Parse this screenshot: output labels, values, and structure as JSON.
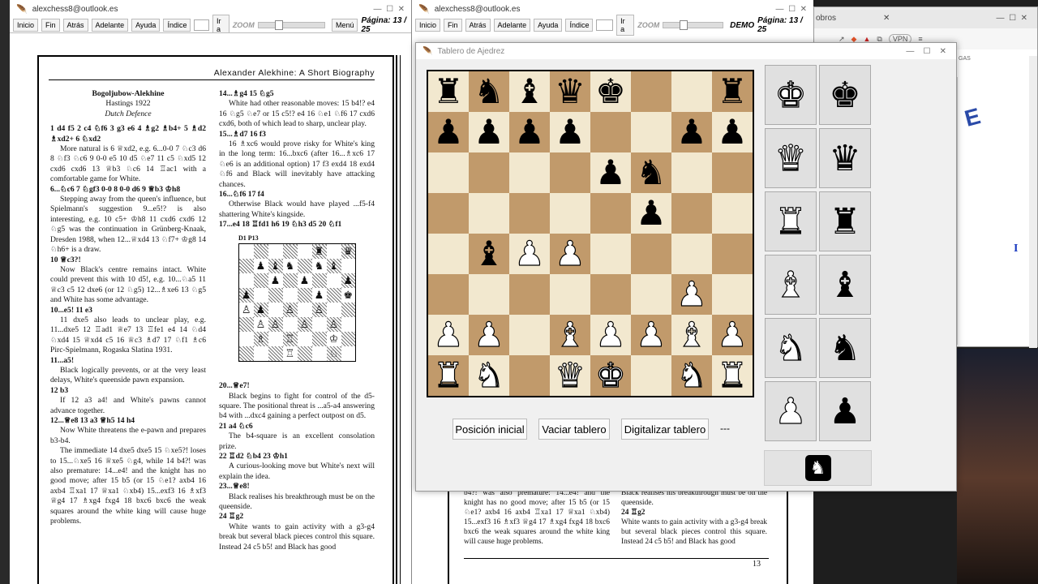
{
  "left_window": {
    "title": "alexchess8@outlook.es",
    "toolbar": [
      "Inicio",
      "Fin",
      "Atrás",
      "Adelante",
      "Ayuda",
      "Índice",
      "Ir a"
    ],
    "zoom": "ZOOM",
    "menu": "Menú",
    "page": "Página: 13 / 25"
  },
  "right_window": {
    "title": "alexchess8@outlook.es",
    "toolbar": [
      "Inicio",
      "Fin",
      "Atrás",
      "Adelante",
      "Ayuda",
      "Índice",
      "Ir a"
    ],
    "zoom": "ZOOM",
    "demo": "DEMO",
    "page": "Página: 13 / 25"
  },
  "browser": {
    "tab": "obros",
    "vpn": "VPN",
    "gas": "GAS",
    "link": "I"
  },
  "doc": {
    "header": "Alexander Alekhine: A Short Biography",
    "game_title": "Bogoljubow-Alekhine",
    "event": "Hastings 1922",
    "opening": "Dutch Defence",
    "left_col": [
      {
        "t": "1 d4 f5 2 c4 ♘f6 3 g3 e6 4 ♗g2 ♗b4+ 5 ♗d2 ♗xd2+ 6 ♘xd2",
        "b": true
      },
      {
        "t": "More natural is 6 ♕xd2, e.g. 6...0-0 7 ♘c3 d6 8 ♘f3 ♘c6 9 0-0 e5 10 d5 ♘e7 11 c5 ♘xd5 12 cxd6 cxd6 13 ♕b3 ♘c6 14 ♖ac1 with a comfortable game for White."
      },
      {
        "t": "6...♘c6 7 ♘gf3 0-0 8 0-0 d6 9 ♕b3 ♔h8",
        "b": true
      },
      {
        "t": "Stepping away from the queen's influence, but Spielmann's suggestion 9...e5!? is also interesting, e.g. 10 c5+ ♔h8 11 cxd6 cxd6 12 ♘g5 was the continuation in Grünberg-Knaak, Dresden 1988, when 12...♕xd4 13 ♘f7+ ♔g8 14 ♘h6+ is a draw."
      },
      {
        "t": "10 ♕c3?!",
        "b": true
      },
      {
        "t": "Now Black's centre remains intact. White could prevent this with 10 d5!, e.g. 10...♘a5 11 ♕c3 c5 12 dxe6 (or 12 ♘g5) 12...♗xe6 13 ♘g5 and White has some advantage."
      },
      {
        "t": "10...e5! 11 e3",
        "b": true
      },
      {
        "t": "11 dxe5 also leads to unclear play, e.g. 11...dxe5 12 ♖ad1 ♕e7 13 ♖fe1 e4 14 ♘d4 ♘xd4 15 ♕xd4 c5 16 ♕c3 ♗d7 17 ♘f1 ♗c6 Pirc-Spielmann, Rogaska Slatina 1931."
      },
      {
        "t": "11...a5!",
        "b": true
      },
      {
        "t": "Black logically prevents, or at the very least delays, White's queenside pawn expansion."
      },
      {
        "t": "12 b3",
        "b": true
      },
      {
        "t": "If 12 a3 a4! and White's pawns cannot advance together."
      },
      {
        "t": "12...♕e8 13 a3 ♕h5 14 h4",
        "b": true
      },
      {
        "t": "Now White threatens the e-pawn and prepares b3-b4."
      },
      {
        "t": "The immediate 14 dxe5 dxe5 15 ♘xe5?! loses to 15...♘xe5 16 ♕xe5 ♘g4, while 14 b4?! was also premature: 14...e4! and the knight has no good move; after 15 b5 (or 15 ♘e1? axb4 16 axb4 ♖xa1 17 ♕xa1 ♘xb4) 15...exf3 16 ♗xf3 ♕g4 17 ♗xg4 fxg4 18 bxc6 bxc6 the weak squares around the white king will cause huge problems."
      }
    ],
    "right_col_a": [
      {
        "t": "14...♗g4 15 ♘g5",
        "b": true
      },
      {
        "t": "White had other reasonable moves: 15 b4!? e4 16 ♘g5 ♘e7 or 15 c5!? e4 16 ♘e1 ♘f6 17 cxd6 cxd6, both of which lead to sharp, unclear play."
      },
      {
        "t": "15...♗d7 16 f3",
        "b": true
      },
      {
        "t": "16 ♗xc6 would prove risky for White's king in the long term: 16...bxc6 (after 16...♗xc6 17 ♘e6 is an additional option) 17 f3 exd4 18 exd4 ♘f6 and Black will inevitably have attacking chances."
      },
      {
        "t": "16...♘f6 17 f4",
        "b": true
      },
      {
        "t": "Otherwise Black would have played ...f5-f4 shattering White's kingside."
      },
      {
        "t": "17...e4 18 ♖fd1 h6 19 ♘h3 d5 20 ♘f1",
        "b": true
      }
    ],
    "diagram_label": "D1 P13",
    "right_col_b": [
      {
        "t": "20...♕e7!",
        "b": true
      },
      {
        "t": "Black begins to fight for control of the d5-square. The positional threat is ...a5-a4 answering b4 with ...dxc4 gaining a perfect outpost on d5."
      },
      {
        "t": "21 a4 ♘c6",
        "b": true
      },
      {
        "t": "The b4-square is an excellent consolation prize."
      },
      {
        "t": "22 ♖d2 ♘b4 23 ♔h1",
        "b": true
      },
      {
        "t": "A curious-looking move but White's next will explain the idea."
      },
      {
        "t": "23...♕e8!",
        "b": true
      },
      {
        "t": "Black realises his breakthrough must be on the queenside."
      },
      {
        "t": "24 ♖g2",
        "b": true
      },
      {
        "t": "White wants to gain activity with a g3-g4 break but several black pieces control this square. Instead 24 c5 b5! and Black has good"
      }
    ],
    "right_page_left": "b4?! was also premature: 14...e4! and the knight has no good move; after 15 b5 (or 15 ♘e1? axb4 16 axb4 ♖xa1 17 ♕xa1 ♘xb4) 15...exf3 16 ♗xf3 ♕g4 17 ♗xg4 fxg4 18 bxc6 bxc6 the weak squares around the white king will cause huge problems.",
    "right_page_right_1": "Black realises his breakthrough must be on the queenside.",
    "right_page_right_2": "24 ♖g2",
    "right_page_right_3": "White wants to gain activity with a g3-g4 break but several black pieces control this square. Instead 24 c5 b5! and Black has good",
    "right_page_number": "13"
  },
  "board_window": {
    "title": "Tablero de Ajedrez",
    "buttons": {
      "initial": "Posición inicial",
      "clear": "Vaciar tablero",
      "digitize": "Digitalizar tablero"
    },
    "status": "---",
    "palette_icons": [
      "white-king-icon",
      "black-king-icon",
      "white-queen-icon",
      "black-queen-icon",
      "white-rook-icon",
      "black-rook-icon",
      "white-bishop-icon",
      "black-bishop-icon",
      "white-knight-icon",
      "black-knight-icon",
      "white-pawn-icon",
      "black-pawn-icon"
    ],
    "board": [
      [
        "r",
        "n",
        "b",
        "q",
        "k",
        "",
        "",
        "r"
      ],
      [
        "p",
        "p",
        "p",
        "p",
        "",
        "",
        "p",
        "p"
      ],
      [
        "",
        "",
        "",
        "",
        "p",
        "n",
        "",
        ""
      ],
      [
        "",
        "",
        "",
        "",
        "",
        "p",
        "",
        ""
      ],
      [
        "",
        "b",
        "P",
        "P",
        "",
        "",
        "",
        ""
      ],
      [
        "",
        "",
        "",
        "",
        "",
        "",
        "P",
        ""
      ],
      [
        "P",
        "P",
        "",
        "B",
        "P",
        "P",
        "B",
        "P"
      ],
      [
        "R",
        "N",
        "",
        "Q",
        "K",
        "",
        "N",
        "R"
      ]
    ],
    "colors": {
      "light": "#f2e8cf",
      "dark": "#c19a6b"
    }
  },
  "mini_board": [
    [
      "",
      "",
      "",
      "",
      "",
      "♜",
      "",
      "♛"
    ],
    [
      "",
      "♟",
      "♝",
      "♞",
      "",
      "♞",
      "♝",
      ""
    ],
    [
      "",
      "",
      "♟",
      "",
      "♟",
      "",
      "",
      "♟"
    ],
    [
      "♟",
      "",
      "",
      "",
      "",
      "♟",
      "",
      "♚"
    ],
    [
      "♙",
      "♟",
      "",
      "♙",
      "",
      "♙",
      "",
      ""
    ],
    [
      "",
      "♙",
      "♙",
      "",
      "♙",
      "",
      "♙",
      ""
    ],
    [
      "",
      "♗",
      "",
      "♖",
      "",
      "",
      "♔",
      ""
    ],
    [
      "",
      "",
      "",
      "♖",
      "",
      "",
      "♘",
      ""
    ]
  ]
}
